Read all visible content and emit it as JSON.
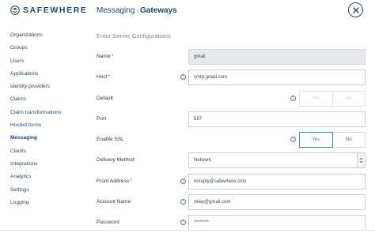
{
  "brand": {
    "name": "SAFEWHERE"
  },
  "header": {
    "section": "Messaging",
    "separator": "›",
    "page": "Gateways"
  },
  "sidebar": {
    "items": [
      {
        "label": "Organizations"
      },
      {
        "label": "Groups"
      },
      {
        "label": "Users"
      },
      {
        "label": "Applications"
      },
      {
        "label": "Identity providers"
      },
      {
        "label": "Claims"
      },
      {
        "label": "Claim transformations"
      },
      {
        "label": "Hosted forms"
      },
      {
        "label": "Messaging",
        "active": true
      },
      {
        "label": "Clients"
      },
      {
        "label": "Integrations"
      },
      {
        "label": "Analytics"
      },
      {
        "label": "Settings"
      },
      {
        "label": "Logging"
      }
    ]
  },
  "form": {
    "subtitle": "Enter Server Configurations",
    "required_mark": "*",
    "help_glyph": "?",
    "name": {
      "label": "Name",
      "value": "gmail"
    },
    "host": {
      "label": "Host",
      "value": "smtp.gmail.com"
    },
    "default": {
      "label": "Default",
      "yes": "Yes",
      "no": "No"
    },
    "port": {
      "label": "Port",
      "value": "587"
    },
    "enable_ssl": {
      "label": "Enable SSL",
      "yes": "Yes",
      "no": "No"
    },
    "delivery_method": {
      "label": "Delivery Method",
      "value": "Network"
    },
    "from_address": {
      "label": "From Address",
      "value": "noreply@safewhere.com"
    },
    "account_name": {
      "label": "Account Name",
      "value": "relay@gmail.com"
    },
    "password": {
      "label": "Password",
      "value": "********"
    }
  },
  "colors": {
    "brand": "#1f4a6e",
    "accent": "#2b9a8b",
    "required": "#d0342c"
  }
}
